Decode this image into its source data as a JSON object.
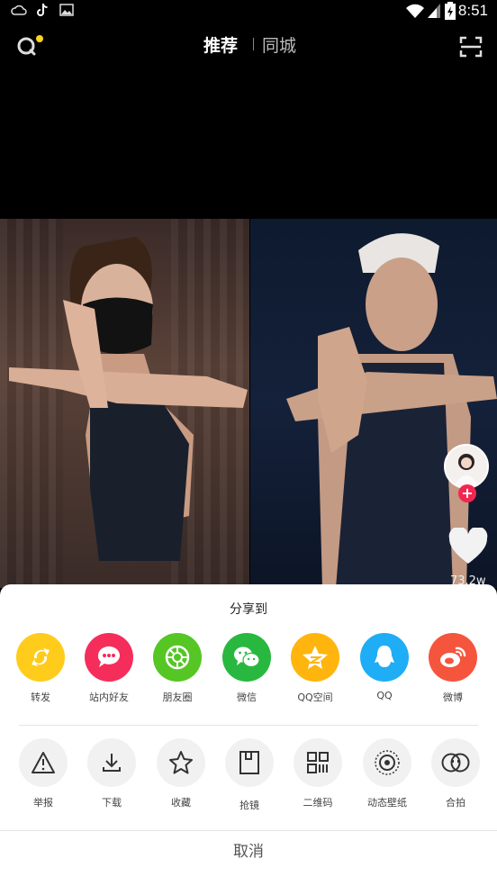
{
  "status_bar": {
    "time": "8:51",
    "icons": [
      "cloud-icon",
      "tiktok-icon",
      "image-icon",
      "wifi-icon",
      "signal-icon",
      "battery-icon"
    ]
  },
  "top_nav": {
    "tab_active": "推荐",
    "tab_other": "同城",
    "search_icon": "search-icon",
    "scan_icon": "scan-icon",
    "notification_color": "#ffd21e"
  },
  "video": {
    "like_count": "73.2w"
  },
  "share_sheet": {
    "title": "分享到",
    "share_targets": [
      {
        "label": "转发",
        "icon": "repost-icon",
        "color": "#ffcc1b"
      },
      {
        "label": "站内好友",
        "icon": "chat-icon",
        "color": "#f52d5b"
      },
      {
        "label": "朋友圈",
        "icon": "moments-icon",
        "color": "#55c624"
      },
      {
        "label": "微信",
        "icon": "wechat-icon",
        "color": "#29b83f"
      },
      {
        "label": "QQ空间",
        "icon": "qzone-icon",
        "color": "#ffb50d"
      },
      {
        "label": "QQ",
        "icon": "qq-icon",
        "color": "#1fadf5"
      },
      {
        "label": "微博",
        "icon": "weibo-icon",
        "color": "#f5553d"
      }
    ],
    "actions": [
      {
        "label": "举报",
        "icon": "warning-icon"
      },
      {
        "label": "下载",
        "icon": "download-icon"
      },
      {
        "label": "收藏",
        "icon": "star-icon"
      },
      {
        "label": "抢镜",
        "icon": "frame-icon"
      },
      {
        "label": "二维码",
        "icon": "qrcode-icon"
      },
      {
        "label": "动态壁纸",
        "icon": "wallpaper-icon"
      },
      {
        "label": "合拍",
        "icon": "duet-icon"
      }
    ],
    "cancel_label": "取消"
  }
}
